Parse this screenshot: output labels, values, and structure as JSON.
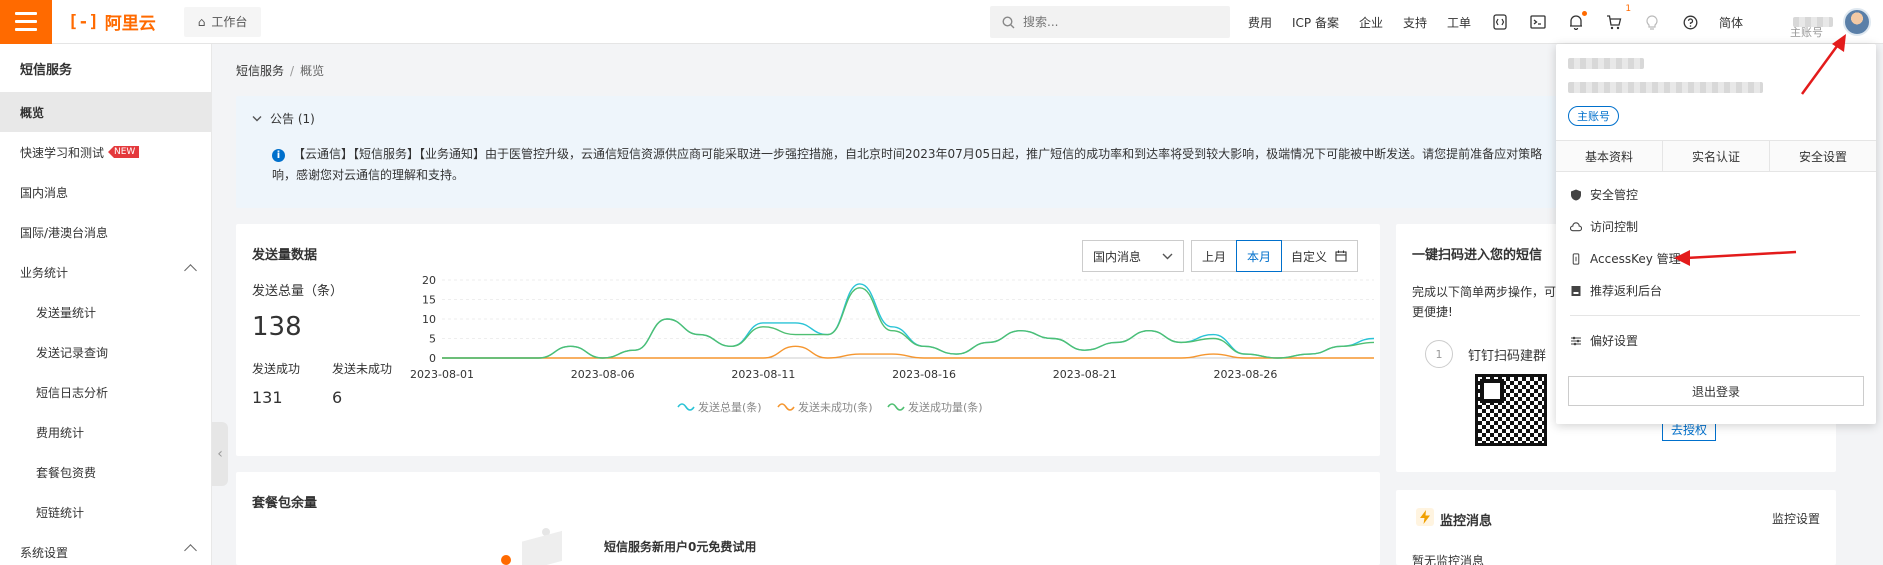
{
  "topbar": {
    "brand": "阿里云",
    "brand_mark": "[-]",
    "workbench": "工作台",
    "search_placeholder": "搜索...",
    "links": [
      "费用",
      "ICP 备案",
      "企业",
      "支持",
      "工单"
    ],
    "lang": "简体",
    "cart_badge": "1",
    "main_account_label": "主账号",
    "icons": [
      "menu-icon",
      "home-icon",
      "search-icon",
      "code-icon",
      "terminal-icon",
      "bell-icon",
      "cart-icon",
      "bulb-icon",
      "help-icon"
    ]
  },
  "sidebar": {
    "title": "短信服务",
    "items": [
      {
        "label": "概览",
        "active": true
      },
      {
        "label": "快速学习和测试",
        "badge": "NEW"
      },
      {
        "label": "国内消息"
      },
      {
        "label": "国际/港澳台消息"
      },
      {
        "label": "业务统计",
        "group": true
      },
      {
        "label": "发送量统计",
        "sub": true
      },
      {
        "label": "发送记录查询",
        "sub": true
      },
      {
        "label": "短信日志分析",
        "sub": true
      },
      {
        "label": "费用统计",
        "sub": true
      },
      {
        "label": "套餐包资费",
        "sub": true
      },
      {
        "label": "短链统计",
        "sub": true
      },
      {
        "label": "系统设置",
        "group": true
      }
    ]
  },
  "breadcrumb": {
    "root": "短信服务",
    "sep": "/",
    "current": "概览"
  },
  "notice": {
    "title": "公告 (1)",
    "line1": "【云通信】【短信服务】【业务通知】由于医管控升级，云通信短信资源供应商可能采取进一步强控措施，自北京时间2023年07月05日起，推广短信的成功率和到达率将受到较大影响，极端情况下可能被中断发送。请您提前准备应对策略",
    "line2": "响，感谢您对云通信的理解和支持。"
  },
  "send_card": {
    "title": "发送量数据",
    "total_label": "发送总量（条）",
    "total_value": "138",
    "success_label": "发送成功",
    "success_value": "131",
    "fail_label": "发送未成功",
    "fail_value": "6",
    "region_select": "国内消息",
    "range_options": [
      "上月",
      "本月",
      "自定义"
    ],
    "range_selected": "本月"
  },
  "chart_data": {
    "type": "line",
    "x": [
      "2023-08-01",
      "2023-08-02",
      "2023-08-03",
      "2023-08-04",
      "2023-08-05",
      "2023-08-06",
      "2023-08-07",
      "2023-08-08",
      "2023-08-09",
      "2023-08-10",
      "2023-08-11",
      "2023-08-12",
      "2023-08-13",
      "2023-08-14",
      "2023-08-15",
      "2023-08-16",
      "2023-08-17",
      "2023-08-18",
      "2023-08-19",
      "2023-08-20",
      "2023-08-21",
      "2023-08-22",
      "2023-08-23",
      "2023-08-24",
      "2023-08-25",
      "2023-08-26",
      "2023-08-27",
      "2023-08-28",
      "2023-08-29",
      "2023-08-30"
    ],
    "x_tick_labels": [
      "2023-08-01",
      "2023-08-06",
      "2023-08-11",
      "2023-08-16",
      "2023-08-21",
      "2023-08-26"
    ],
    "ylim": [
      0,
      20
    ],
    "y_ticks": [
      0,
      5,
      10,
      15,
      20
    ],
    "grid": true,
    "legend_position": "bottom",
    "series": [
      {
        "name": "发送总量(条)",
        "color": "#29c3d6",
        "values": [
          0,
          0,
          0,
          0,
          3,
          0,
          2,
          10,
          6,
          3,
          9,
          9,
          6,
          19,
          8,
          3,
          1,
          4,
          7,
          5,
          2,
          4,
          7,
          4,
          6,
          1,
          0,
          1,
          3,
          5
        ]
      },
      {
        "name": "发送未成功(条)",
        "color": "#f5962f",
        "values": [
          0,
          0,
          0,
          0,
          0,
          0,
          0,
          0,
          0,
          0,
          0,
          3,
          0,
          1,
          1,
          0,
          0,
          0,
          0,
          0,
          0,
          0,
          0,
          0,
          1,
          0,
          0,
          0,
          0,
          0
        ]
      },
      {
        "name": "发送成功量(条)",
        "color": "#4fbf72",
        "values": [
          0,
          0,
          0,
          0,
          3,
          0,
          2,
          10,
          6,
          3,
          8,
          6,
          6,
          18,
          7,
          3,
          1,
          4,
          7,
          5,
          2,
          4,
          7,
          4,
          5,
          1,
          0,
          1,
          3,
          4
        ]
      }
    ]
  },
  "package_card": {
    "title": "套餐包余量",
    "promo": "短信服务新用户0元免费试用"
  },
  "scan_card": {
    "title": "一键扫码进入您的短信",
    "desc1": "完成以下简单两步操作，可",
    "desc2": "更便捷!",
    "step_no": "1",
    "step_text": "钉钉扫码建群",
    "auth_button": "去授权"
  },
  "monitor_card": {
    "title": "监控消息",
    "settings": "监控设置",
    "empty": "暂无监控消息"
  },
  "user_panel": {
    "main_account_tag": "主账号",
    "tabs": [
      "基本资料",
      "实名认证",
      "安全设置"
    ],
    "menu": [
      {
        "label": "安全管控",
        "icon": "shield-icon"
      },
      {
        "label": "访问控制",
        "icon": "cloud-icon"
      },
      {
        "label": "AccessKey 管理",
        "icon": "key-icon"
      },
      {
        "label": "推荐返利后台",
        "icon": "book-icon"
      }
    ],
    "preferences": "偏好设置",
    "logout": "退出登录"
  }
}
